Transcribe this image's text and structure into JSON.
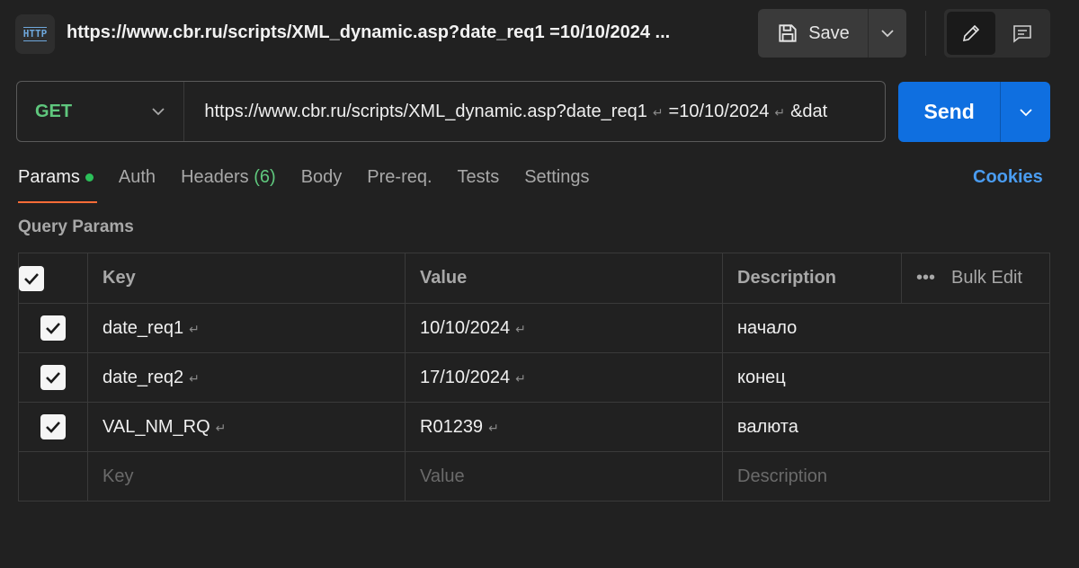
{
  "header": {
    "icon_label": "HTTP",
    "title": "https://www.cbr.ru/scripts/XML_dynamic.asp?date_req1 =10/10/2024 ...",
    "save_label": "Save"
  },
  "request": {
    "method": "GET",
    "url_parts": [
      "https://www.cbr.ru/scripts/XML_dynamic.asp?date_req1",
      "=10/10/2024",
      "&dat"
    ],
    "return_glyph": "↵",
    "send_label": "Send"
  },
  "tabs": [
    {
      "label": "Params"
    },
    {
      "label": "Auth"
    },
    {
      "label": "Headers",
      "count": "(6)"
    },
    {
      "label": "Body"
    },
    {
      "label": "Pre-req."
    },
    {
      "label": "Tests"
    },
    {
      "label": "Settings"
    }
  ],
  "cookies_label": "Cookies",
  "section_title": "Query Params",
  "table": {
    "headers": {
      "key": "Key",
      "value": "Value",
      "description": "Description",
      "bulk_edit": "Bulk Edit"
    },
    "rows": [
      {
        "key": "date_req1",
        "value": "10/10/2024",
        "description": "начало",
        "checked": true
      },
      {
        "key": "date_req2",
        "value": "17/10/2024",
        "description": "конец",
        "checked": true
      },
      {
        "key": "VAL_NM_RQ",
        "value": "R01239",
        "description": "валюта",
        "checked": true
      }
    ],
    "placeholders": {
      "key": "Key",
      "value": "Value",
      "description": "Description"
    }
  },
  "colors": {
    "accent": "#0f6fe0",
    "method": "#5fc77d",
    "tab_underline": "#ff6c37",
    "link": "#4a9cf0"
  }
}
